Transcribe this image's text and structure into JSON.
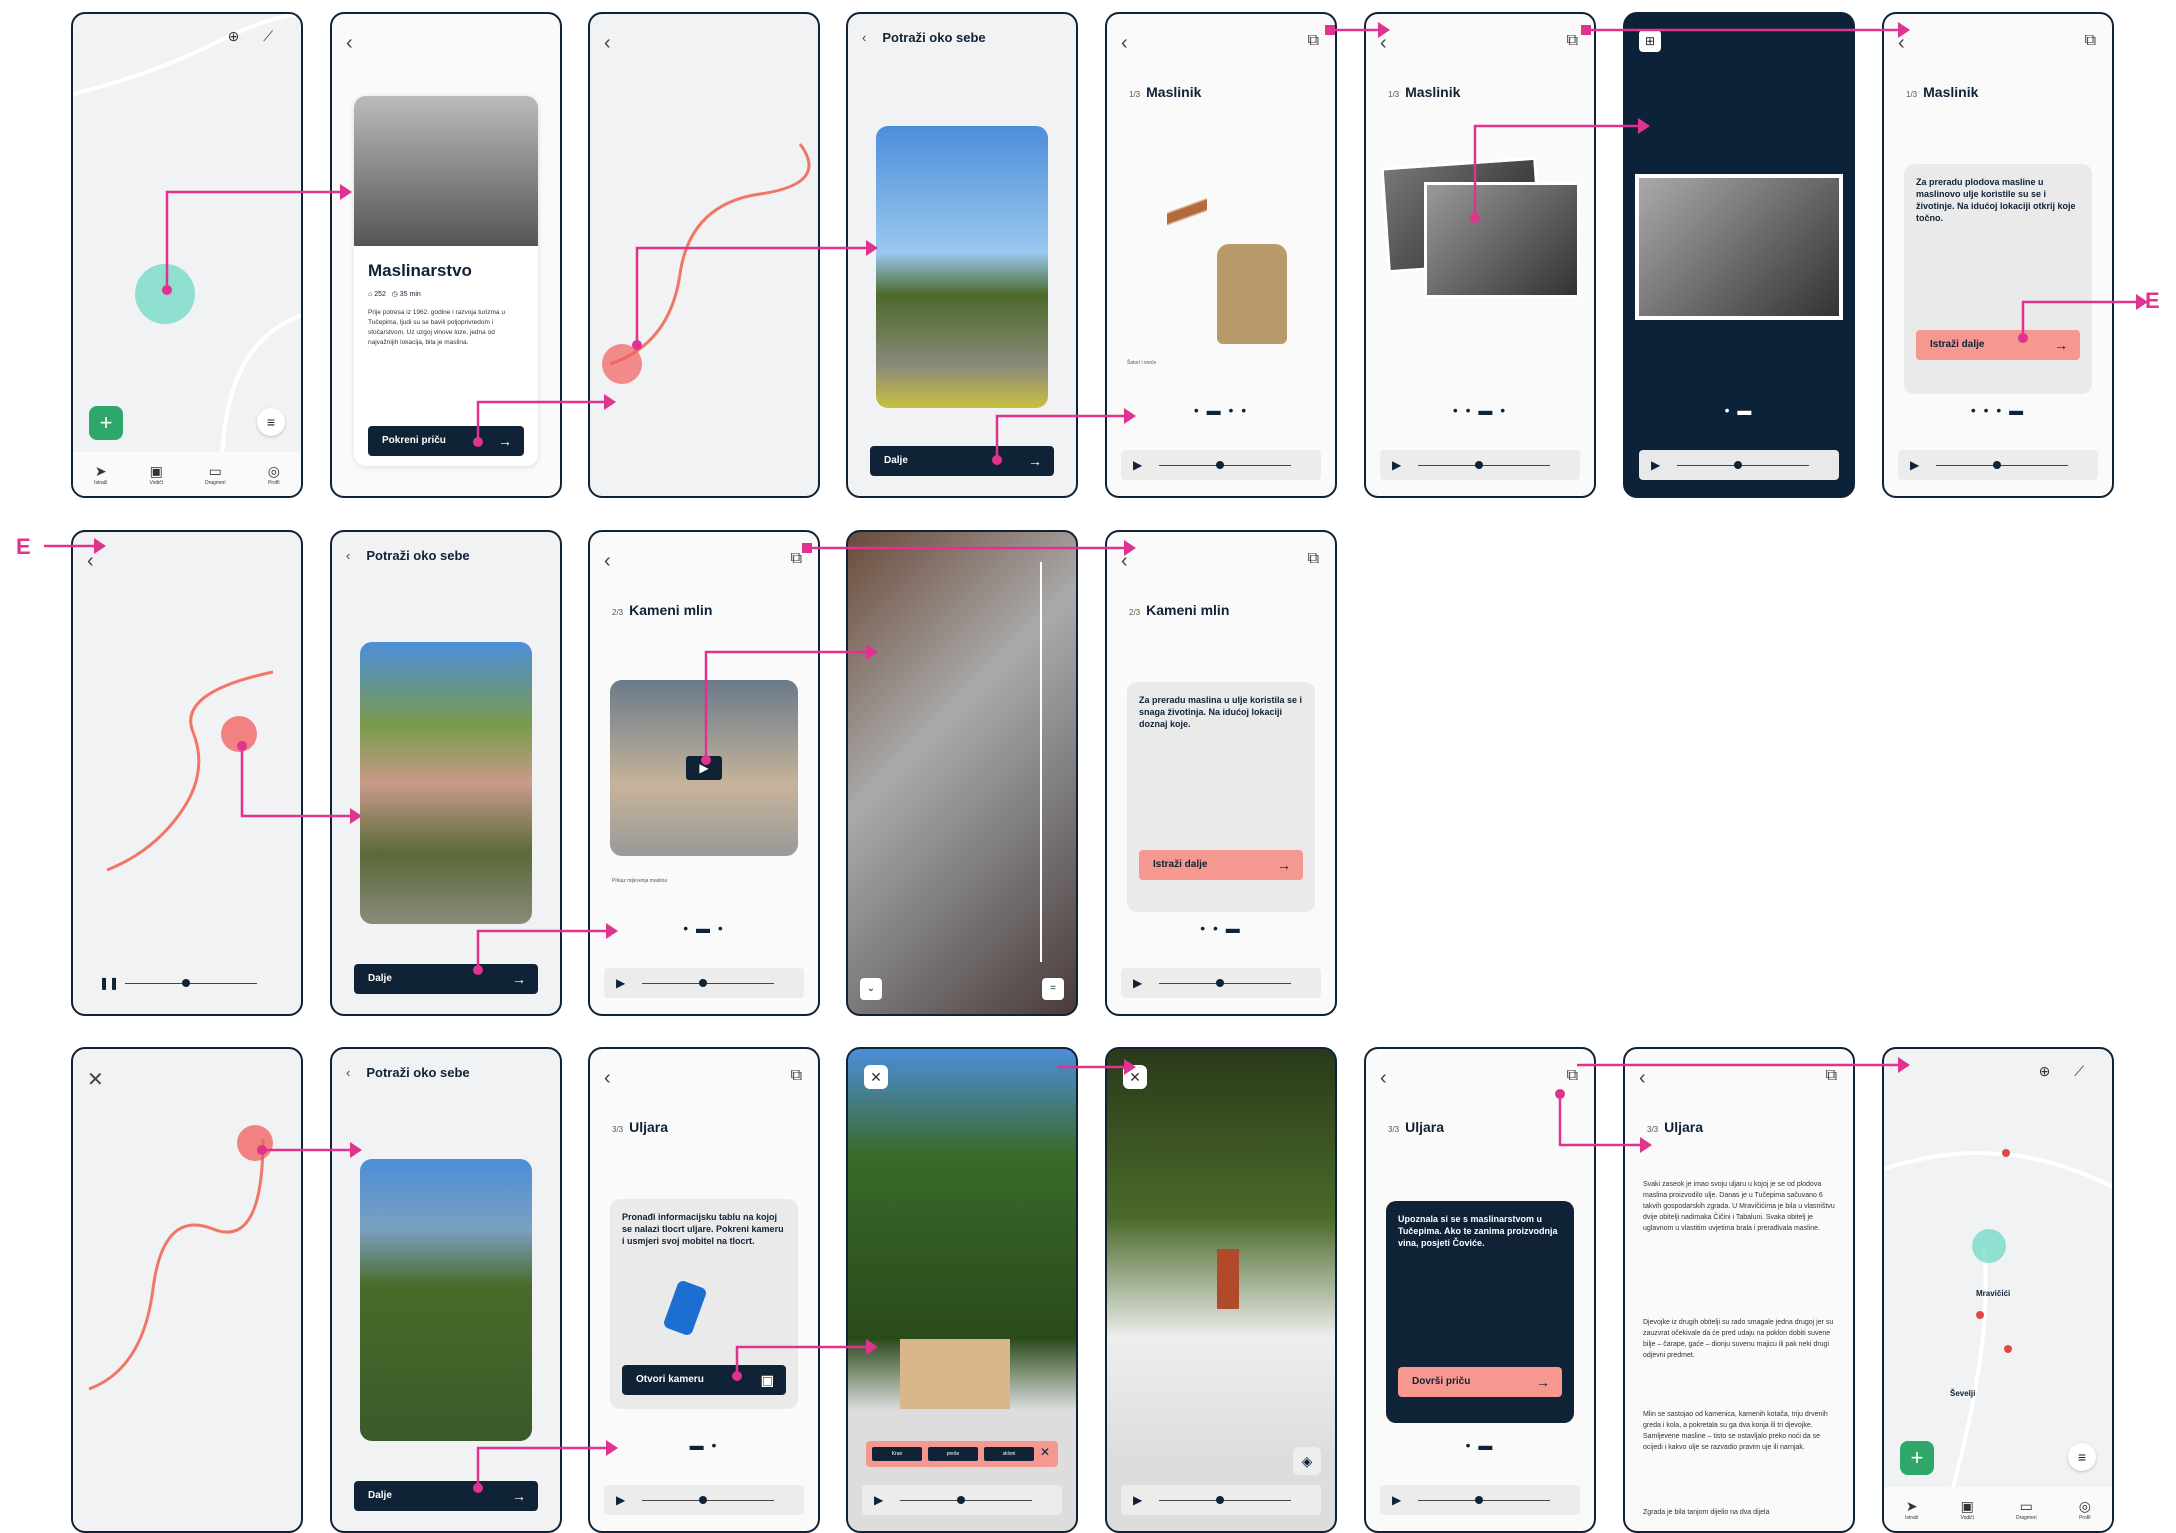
{
  "e_label": "E",
  "screens": {
    "intro": {
      "title": "Maslinarstvo",
      "meta_a": "252",
      "meta_b": "35 min",
      "desc": "Prije potresa iz 1962. godine i razvoja turizma u Tučepima, ljudi su se bavili poljoprivredom i stočarstvom. Uz uzgoj vinove loze, jedna od najvažnijih lokacija, bila je maslina.",
      "button": "Pokreni priču"
    },
    "look_around": {
      "header": "Potraži oko sebe",
      "button": "Dalje"
    },
    "maslinik": {
      "counter": "1/3",
      "title": "Maslinik",
      "caption": "Šatori i vreće",
      "text": "Za preradu plodova masline u maslinovo ulje koristile su se i životinje. Na idućoj lokaciji otkrij koje točno.",
      "button": "Istraži dalje"
    },
    "kameni_mlin": {
      "counter": "2/3",
      "title": "Kameni mlin",
      "caption": "Prikaz mljevenja maslina",
      "text": "Za preradu maslina u ulje koristila se i snaga životinja. Na idućoj lokaciji doznaj koje.",
      "button": "Istraži dalje"
    },
    "uljara": {
      "counter": "3/3",
      "title": "Uljara",
      "text": "Pronađi informacijsku tablu na kojoj se nalazi tlocrt uljare. Pokreni kameru i usmjeri svoj mobitel na tlocrt.",
      "button": "Otvori kameru",
      "ar_pills": [
        "Kran",
        "preše",
        "skloni"
      ],
      "finish_text": "Upoznala si se s maslinarstvom u Tučepima. Ako te zanima proizvodnja vina, posjeti Čoviće.",
      "finish_button": "Dovrši priču",
      "article_p1": "Svaki zaseok je imao svoju uljaru u kojoj je se od plodova maslina proizvodilo ulje. Danas je u Tučepima sačuvano 6 takvih gospodarskih zgrada. U Mravičićima je bila u vlasništvu dvije obitelji nadimaka Čičini i Tabaluni. Svaka obitelj je uglavnom u vlastitim uvjetima brala i prerađivala masline.",
      "article_p2": "Djevojke iz drugih obitelji su rado smagale jedna drugoj jer su zauzvrat očekivale da će pred udaju na poklon dobiti suvene bilje – čarape, gaće – dionju suvenu majicu ili pak neki drugi odjevni predmet.",
      "article_p3": "Mlin se sastojao od kamenica, kamenih kotača, triju drvenih greda i kola, a pokretala su ga dva konja ili tri djevojke. Samljevene masline – tisto se ostavljalo preko noći da se ocijedi i kakvo ulje se razvadio pravim uje ili narnjak.",
      "article_p4": "Zgrada je bila tanjom dijelio na dva dijela"
    },
    "map": {
      "places": [
        "Mravičići",
        "Ševelji"
      ]
    }
  },
  "tabs": [
    "Istraži",
    "Vodiči",
    "Dragmeri",
    "Profil"
  ]
}
